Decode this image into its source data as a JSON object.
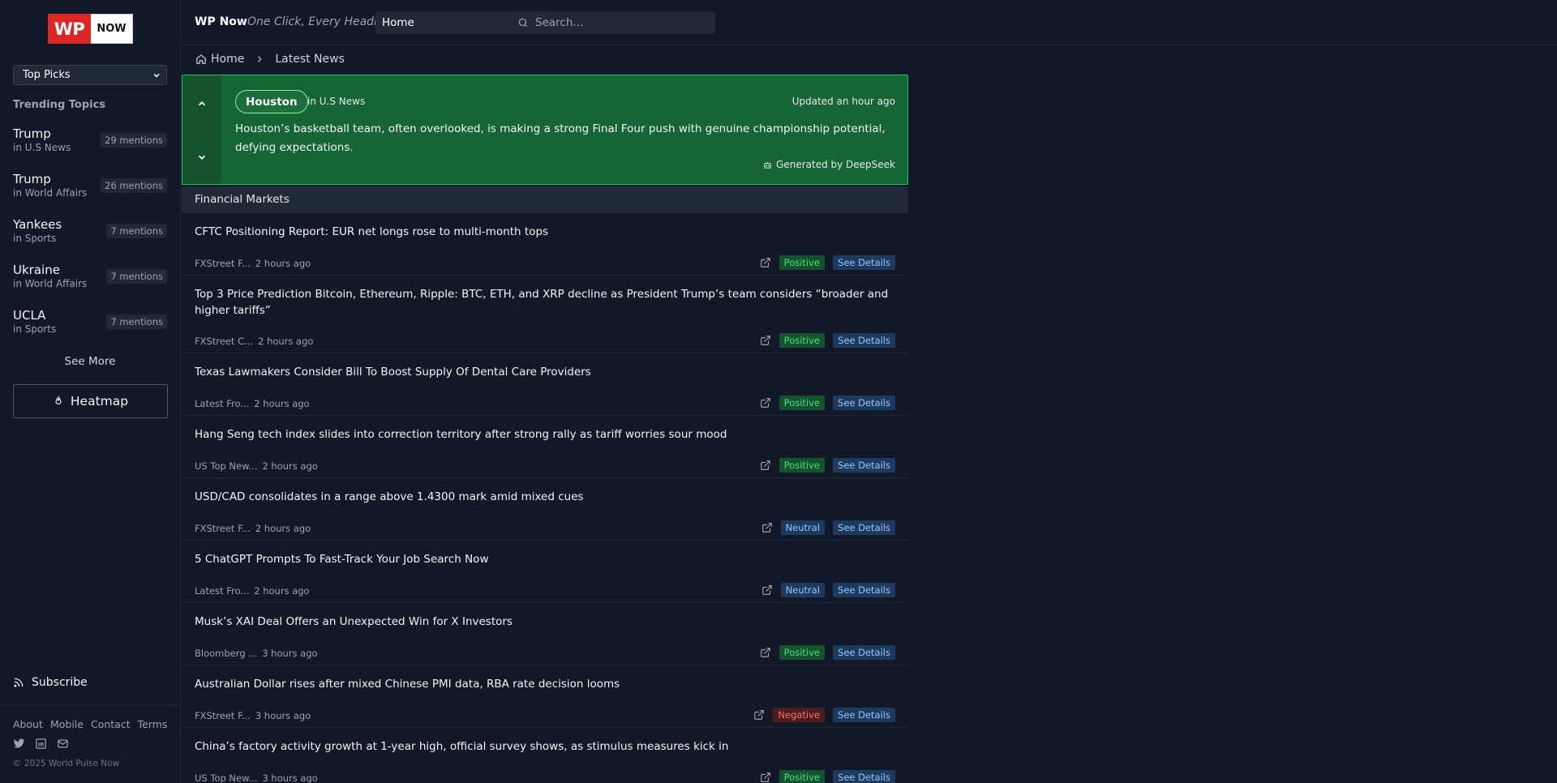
{
  "logo": {
    "left": "WP",
    "right": "NOW"
  },
  "sidebar": {
    "picks_label": "Top Picks",
    "trending_title": "Trending Topics",
    "topics": [
      {
        "name": "Trump",
        "category": "in U.S News",
        "mentions": "29 mentions"
      },
      {
        "name": "Trump",
        "category": "in World Affairs",
        "mentions": "26 mentions"
      },
      {
        "name": "Yankees",
        "category": "in Sports",
        "mentions": "7 mentions"
      },
      {
        "name": "Ukraine",
        "category": "in World Affairs",
        "mentions": "7 mentions"
      },
      {
        "name": "UCLA",
        "category": "in Sports",
        "mentions": "7 mentions"
      }
    ],
    "see_more": "See More",
    "heatmap": "Heatmap",
    "subscribe": "Subscribe",
    "footer_links": [
      "About",
      "Mobile",
      "Contact",
      "Terms"
    ],
    "socials": [
      "twitter-icon",
      "linkedin-icon",
      "mail-icon"
    ],
    "copyright": "© 2025 World Pulse Now"
  },
  "header": {
    "brand": "WP Now",
    "tagline": "One Click, Every Headline",
    "nav_select": "Home",
    "search_placeholder": "Search..."
  },
  "breadcrumb": {
    "home": "Home",
    "current": "Latest News"
  },
  "summary": {
    "topic": "Houston",
    "category": "in U.S News",
    "updated": "Updated an hour ago",
    "text": "Houston’s basketball team, often overlooked, is making a strong Final Four push with genuine championship potential, defying expectations.",
    "generated_by": "Generated by DeepSeek"
  },
  "section_title": "Financial Markets",
  "news": [
    {
      "title": "CFTC Positioning Report: EUR net longs rose to multi-month tops",
      "source": "FXStreet F...",
      "time": "2 hours ago",
      "sentiment": "Positive",
      "sentiment_type": "pos",
      "details": "See Details"
    },
    {
      "title": "Top 3 Price Prediction Bitcoin, Ethereum, Ripple: BTC, ETH, and XRP decline as President Trump’s team considers “broader and higher tariffs”",
      "source": "FXStreet C...",
      "time": "2 hours ago",
      "sentiment": "Positive",
      "sentiment_type": "pos",
      "details": "See Details"
    },
    {
      "title": "Texas Lawmakers Consider Bill To Boost Supply Of Dental Care Providers",
      "source": "Latest Fro...",
      "time": "2 hours ago",
      "sentiment": "Positive",
      "sentiment_type": "pos",
      "details": "See Details"
    },
    {
      "title": "Hang Seng tech index slides into correction territory after strong rally as tariff worries sour mood",
      "source": "US Top New...",
      "time": "2 hours ago",
      "sentiment": "Positive",
      "sentiment_type": "pos",
      "details": "See Details"
    },
    {
      "title": "USD/CAD consolidates in a range above 1.4300 mark amid mixed cues",
      "source": "FXStreet F...",
      "time": "2 hours ago",
      "sentiment": "Neutral",
      "sentiment_type": "neu",
      "details": "See Details"
    },
    {
      "title": "5 ChatGPT Prompts To Fast-Track Your Job Search Now",
      "source": "Latest Fro...",
      "time": "2 hours ago",
      "sentiment": "Neutral",
      "sentiment_type": "neu",
      "details": "See Details"
    },
    {
      "title": "Musk’s XAI Deal Offers an Unexpected Win for X Investors",
      "source": "Bloomberg ...",
      "time": "3 hours ago",
      "sentiment": "Positive",
      "sentiment_type": "pos",
      "details": "See Details"
    },
    {
      "title": "Australian Dollar rises after mixed Chinese PMI data, RBA rate decision looms",
      "source": "FXStreet F...",
      "time": "3 hours ago",
      "sentiment": "Negative",
      "sentiment_type": "neg",
      "details": "See Details"
    },
    {
      "title": "China’s factory activity growth at 1-year high, official survey shows, as stimulus measures kick in",
      "source": "US Top New...",
      "time": "3 hours ago",
      "sentiment": "Positive",
      "sentiment_type": "pos",
      "details": "See Details"
    }
  ]
}
